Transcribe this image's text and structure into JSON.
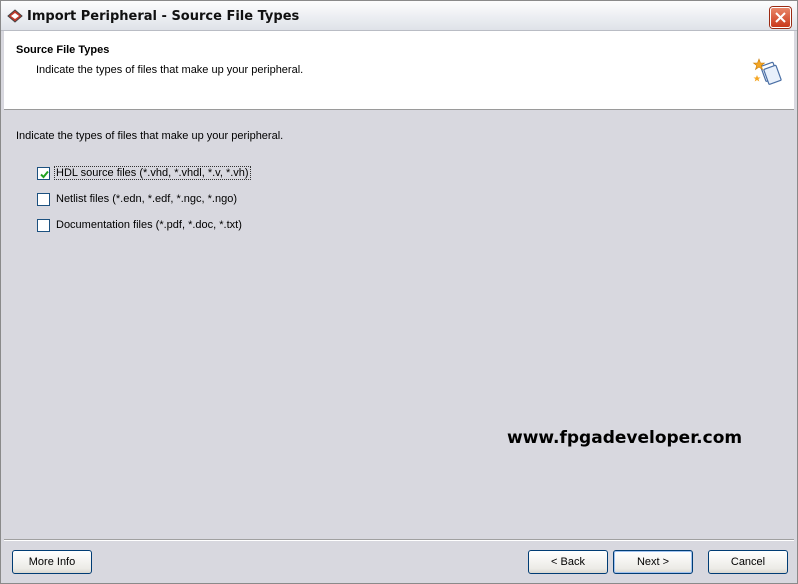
{
  "window": {
    "title": "Import Peripheral - Source File Types",
    "icons": {
      "app": "xilinx-app-icon",
      "close": "close-icon"
    }
  },
  "header": {
    "title": "Source File Types",
    "subtitle": "Indicate the types of files that make up your peripheral.",
    "icon": "wizard-icon"
  },
  "content": {
    "intro": "Indicate the types of files that make up your peripheral.",
    "options": [
      {
        "label": "HDL source files (*.vhd, *.vhdl, *.v, *.vh)",
        "checked": true
      },
      {
        "label": "Netlist files (*.edn, *.edf, *.ngc, *.ngo)",
        "checked": false
      },
      {
        "label": "Documentation files (*.pdf, *.doc, *.txt)",
        "checked": false
      }
    ],
    "watermark": "www.fpgadeveloper.com"
  },
  "footer": {
    "more_info": "More Info",
    "back": "< Back",
    "next": "Next >",
    "cancel": "Cancel"
  },
  "colors": {
    "background": "#d8d8df",
    "close_button": "#c9381b",
    "checkmark": "#21a121",
    "button_border": "#003c74"
  }
}
